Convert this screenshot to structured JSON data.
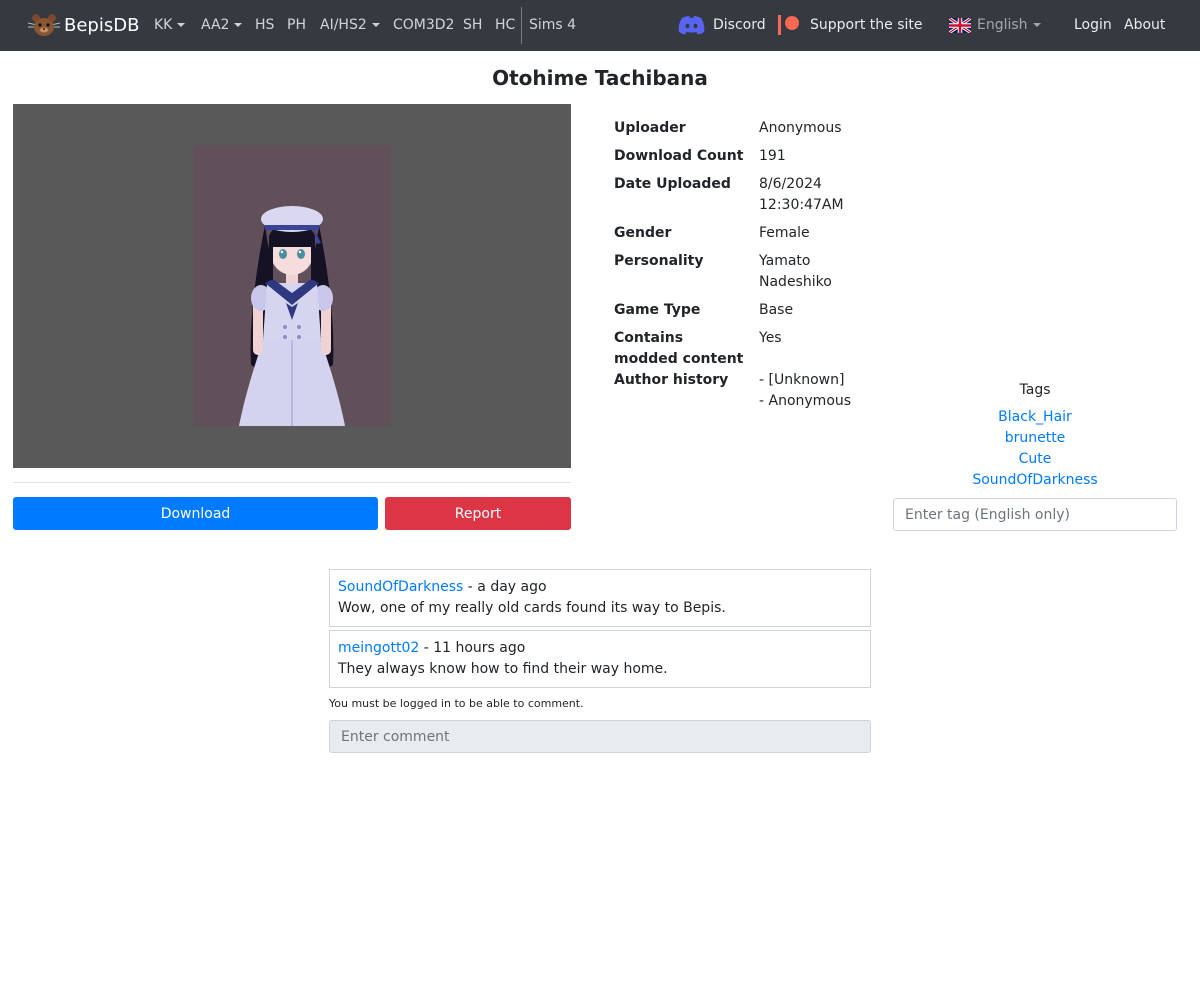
{
  "navbar": {
    "brand": "BepisDB",
    "items": [
      {
        "label": "KK",
        "dropdown": true
      },
      {
        "label": "AA2",
        "dropdown": true
      },
      {
        "label": "HS",
        "dropdown": false
      },
      {
        "label": "PH",
        "dropdown": false
      },
      {
        "label": "AI/HS2",
        "dropdown": true
      },
      {
        "label": "COM3D2",
        "dropdown": false
      },
      {
        "label": "SH",
        "dropdown": false
      },
      {
        "label": "HC",
        "dropdown": false
      },
      {
        "label": "Sims 4",
        "dropdown": false
      }
    ],
    "discord": "Discord",
    "support": "Support the site",
    "language": "English",
    "login": "Login",
    "about": "About"
  },
  "card": {
    "title": "Otohime Tachibana",
    "download_label": "Download",
    "report_label": "Report"
  },
  "info": {
    "uploader_label": "Uploader",
    "uploader": "Anonymous",
    "download_count_label": "Download Count",
    "download_count": "191",
    "date_label": "Date Uploaded",
    "date_line1": "8/6/2024",
    "date_line2": "12:30:47AM",
    "gender_label": "Gender",
    "gender": "Female",
    "personality_label": "Personality",
    "personality_line1": "Yamato",
    "personality_line2": "Nadeshiko",
    "game_type_label": "Game Type",
    "game_type": "Base",
    "modded_label_line1": "Contains",
    "modded_label_line2": "modded content",
    "modded": "Yes",
    "author_history_label": "Author history",
    "author_history_line1": "- [Unknown]",
    "author_history_line2": "- Anonymous"
  },
  "tags": {
    "title": "Tags",
    "items": [
      "Black_Hair",
      "brunette",
      "Cute",
      "SoundOfDarkness"
    ],
    "input_placeholder": "Enter tag (English only)"
  },
  "comments": {
    "items": [
      {
        "author": "SoundOfDarkness",
        "time": " - a day ago",
        "text": "Wow, one of my really old cards found its way to Bepis."
      },
      {
        "author": "meingott02",
        "time": " - 11 hours ago",
        "text": "They always know how to find their way home."
      }
    ],
    "login_note": "You must be logged in to be able to comment.",
    "input_placeholder": "Enter comment"
  },
  "colors": {
    "navbar_bg": "#343a40",
    "primary": "#007bff",
    "danger": "#dc3545",
    "patreon": "#f96854",
    "discord": "#5865f2"
  }
}
